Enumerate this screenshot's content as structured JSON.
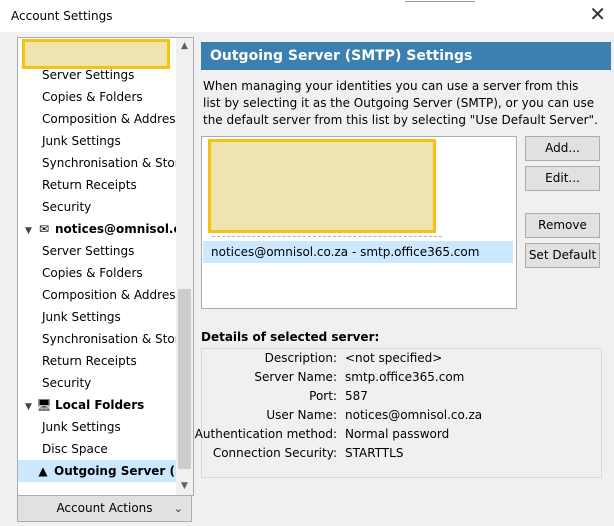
{
  "window": {
    "title": "Account Settings",
    "close_glyph": "✕"
  },
  "tree": {
    "group1_items": [
      "Server Settings",
      "Copies & Folders",
      "Composition & Addressing",
      "Junk Settings",
      "Synchronisation & Storage",
      "Return Receipts",
      "Security"
    ],
    "account2_label": "notices@omnisol.co.za",
    "group2_items": [
      "Server Settings",
      "Copies & Folders",
      "Composition & Addressing",
      "Junk Settings",
      "Synchronisation & Storage",
      "Return Receipts",
      "Security"
    ],
    "local_label": "Local Folders",
    "local_items": [
      "Junk Settings",
      "Disc Space"
    ],
    "outgoing_label": "Outgoing Server (SMTP)"
  },
  "account_actions": "Account Actions",
  "panel": {
    "title": "Outgoing Server (SMTP) Settings",
    "description": "When managing your identities you can use a server from this list by selecting it as the Outgoing Server (SMTP), or you can use the default server from this list by selecting \"Use Default Server\".",
    "selected_server": "notices@omnisol.co.za - smtp.office365.com",
    "buttons": {
      "add": "Add...",
      "edit": "Edit...",
      "remove": "Remove",
      "set_default": "Set Default"
    },
    "details": {
      "heading": "Details of selected server:",
      "rows": [
        {
          "k": "Description:",
          "v": "<not specified>"
        },
        {
          "k": "Server Name:",
          "v": "smtp.office365.com"
        },
        {
          "k": "Port:",
          "v": "587"
        },
        {
          "k": "User Name:",
          "v": "notices@omnisol.co.za"
        },
        {
          "k": "Authentication method:",
          "v": "Normal password"
        },
        {
          "k": "Connection Security:",
          "v": "STARTTLS"
        }
      ]
    }
  }
}
